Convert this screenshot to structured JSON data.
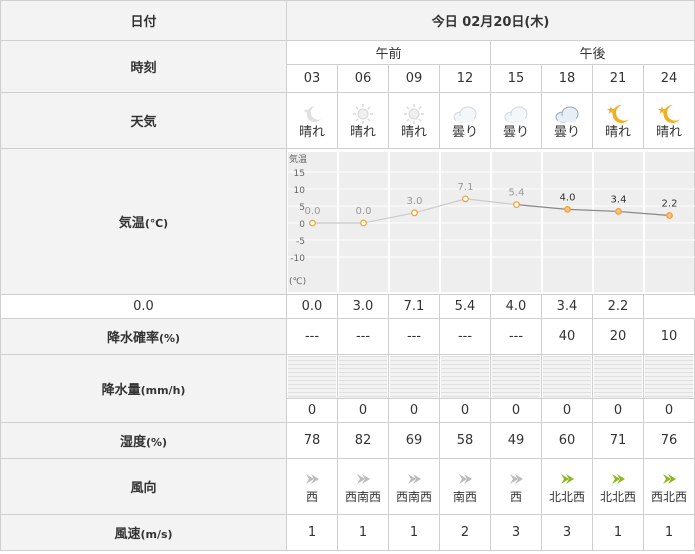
{
  "header": {
    "label": "日付",
    "date": "今日 02月20日(木)"
  },
  "period": {
    "label": "時刻",
    "am": "午前",
    "pm": "午後"
  },
  "hours": [
    "03",
    "06",
    "09",
    "12",
    "15",
    "18",
    "21",
    "24"
  ],
  "past_flags": [
    true,
    true,
    true,
    true,
    true,
    false,
    false,
    false
  ],
  "weather": {
    "label": "天気",
    "items": [
      {
        "text": "晴れ",
        "icon": "moon-icon"
      },
      {
        "text": "晴れ",
        "icon": "sun-icon"
      },
      {
        "text": "晴れ",
        "icon": "sun-icon"
      },
      {
        "text": "曇り",
        "icon": "cloud-icon"
      },
      {
        "text": "曇り",
        "icon": "cloud-icon"
      },
      {
        "text": "曇り",
        "icon": "cloud-icon"
      },
      {
        "text": "晴れ",
        "icon": "moon-star-icon"
      },
      {
        "text": "晴れ",
        "icon": "moon-star-icon"
      }
    ]
  },
  "temperature": {
    "label": "気温",
    "unit": "(℃)",
    "values": [
      "0.0",
      "0.0",
      "3.0",
      "7.1",
      "5.4",
      "4.0",
      "3.4",
      "2.2"
    ]
  },
  "precip_prob": {
    "label": "降水確率",
    "unit": "(%)",
    "values": [
      "---",
      "---",
      "---",
      "---",
      "---",
      "40",
      "20",
      "10"
    ]
  },
  "precip_amount": {
    "label": "降水量",
    "unit": "(mm/h)",
    "values": [
      "0",
      "0",
      "0",
      "0",
      "0",
      "0",
      "0",
      "0"
    ]
  },
  "humidity": {
    "label": "湿度",
    "unit": "(%)",
    "values": [
      "78",
      "82",
      "69",
      "58",
      "49",
      "60",
      "71",
      "76"
    ]
  },
  "wind_dir": {
    "label": "風向",
    "values": [
      "西",
      "西南西",
      "西南西",
      "南西",
      "西",
      "北北西",
      "北北西",
      "西北西"
    ]
  },
  "wind_speed": {
    "label": "風速",
    "unit": "(m/s)",
    "values": [
      "1",
      "1",
      "1",
      "2",
      "3",
      "3",
      "1",
      "1"
    ]
  },
  "colors": {
    "past": "#aaaaaa",
    "accent": "#8ab820",
    "line_past": "#cccccc",
    "line_future": "#888888",
    "point": "#f0a030"
  },
  "chart_data": {
    "type": "line",
    "ylabel": "気温",
    "yunit": "(℃)",
    "x": [
      "03",
      "06",
      "09",
      "12",
      "15",
      "18",
      "21",
      "24"
    ],
    "series": [
      {
        "values": [
          0.0,
          0.0,
          3.0,
          7.1,
          5.4,
          4.0,
          3.4,
          2.2
        ]
      }
    ],
    "ylim": [
      -15,
      15
    ],
    "yticks": [
      "15",
      "10",
      "5",
      "0",
      "-5",
      "-10"
    ],
    "grid": true
  }
}
